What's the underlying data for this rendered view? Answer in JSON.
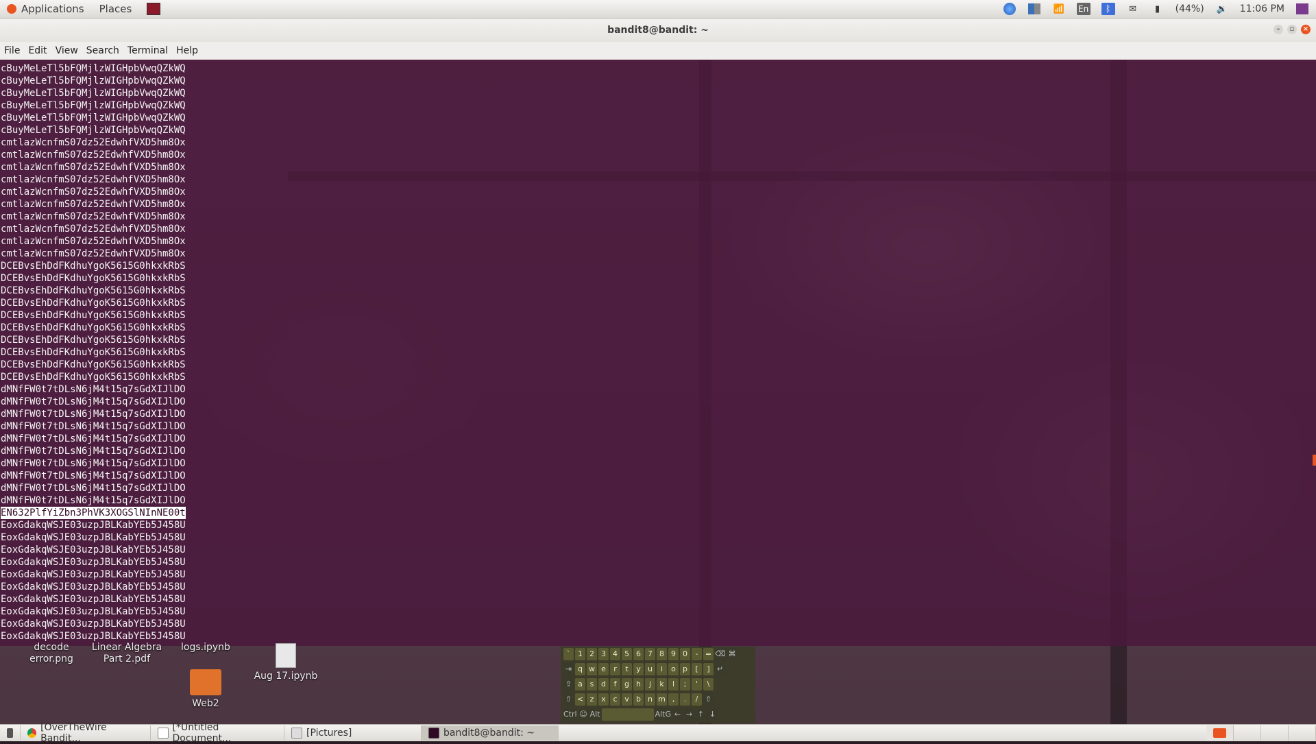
{
  "top_panel": {
    "applications": "Applications",
    "places": "Places",
    "keyboard_layout": "En",
    "battery": "(44%)",
    "clock": "11:06 PM"
  },
  "window": {
    "title": "bandit8@bandit: ~"
  },
  "menubar": [
    "File",
    "Edit",
    "View",
    "Search",
    "Terminal",
    "Help"
  ],
  "terminal": {
    "lines": [
      "cBuyMeLeTl5bFQMjlzWIGHpbVwqQZkWQ",
      "cBuyMeLeTl5bFQMjlzWIGHpbVwqQZkWQ",
      "cBuyMeLeTl5bFQMjlzWIGHpbVwqQZkWQ",
      "cBuyMeLeTl5bFQMjlzWIGHpbVwqQZkWQ",
      "cBuyMeLeTl5bFQMjlzWIGHpbVwqQZkWQ",
      "cBuyMeLeTl5bFQMjlzWIGHpbVwqQZkWQ",
      "cmtlazWcnfmS07dz52EdwhfVXD5hm8Ox",
      "cmtlazWcnfmS07dz52EdwhfVXD5hm8Ox",
      "cmtlazWcnfmS07dz52EdwhfVXD5hm8Ox",
      "cmtlazWcnfmS07dz52EdwhfVXD5hm8Ox",
      "cmtlazWcnfmS07dz52EdwhfVXD5hm8Ox",
      "cmtlazWcnfmS07dz52EdwhfVXD5hm8Ox",
      "cmtlazWcnfmS07dz52EdwhfVXD5hm8Ox",
      "cmtlazWcnfmS07dz52EdwhfVXD5hm8Ox",
      "cmtlazWcnfmS07dz52EdwhfVXD5hm8Ox",
      "cmtlazWcnfmS07dz52EdwhfVXD5hm8Ox",
      "DCEBvsEhDdFKdhuYgoK5615G0hkxkRbS",
      "DCEBvsEhDdFKdhuYgoK5615G0hkxkRbS",
      "DCEBvsEhDdFKdhuYgoK5615G0hkxkRbS",
      "DCEBvsEhDdFKdhuYgoK5615G0hkxkRbS",
      "DCEBvsEhDdFKdhuYgoK5615G0hkxkRbS",
      "DCEBvsEhDdFKdhuYgoK5615G0hkxkRbS",
      "DCEBvsEhDdFKdhuYgoK5615G0hkxkRbS",
      "DCEBvsEhDdFKdhuYgoK5615G0hkxkRbS",
      "DCEBvsEhDdFKdhuYgoK5615G0hkxkRbS",
      "DCEBvsEhDdFKdhuYgoK5615G0hkxkRbS",
      "dMNfFW0t7tDLsN6jM4t15q7sGdXIJlDO",
      "dMNfFW0t7tDLsN6jM4t15q7sGdXIJlDO",
      "dMNfFW0t7tDLsN6jM4t15q7sGdXIJlDO",
      "dMNfFW0t7tDLsN6jM4t15q7sGdXIJlDO",
      "dMNfFW0t7tDLsN6jM4t15q7sGdXIJlDO",
      "dMNfFW0t7tDLsN6jM4t15q7sGdXIJlDO",
      "dMNfFW0t7tDLsN6jM4t15q7sGdXIJlDO",
      "dMNfFW0t7tDLsN6jM4t15q7sGdXIJlDO",
      "dMNfFW0t7tDLsN6jM4t15q7sGdXIJlDO",
      "dMNfFW0t7tDLsN6jM4t15q7sGdXIJlDO",
      "EN632PlfYiZbn3PhVK3XOGSlNInNE00t",
      "EoxGdakqWSJE03uzpJBLKabYEb5J458U",
      "EoxGdakqWSJE03uzpJBLKabYEb5J458U",
      "EoxGdakqWSJE03uzpJBLKabYEb5J458U",
      "EoxGdakqWSJE03uzpJBLKabYEb5J458U",
      "EoxGdakqWSJE03uzpJBLKabYEb5J458U",
      "EoxGdakqWSJE03uzpJBLKabYEb5J458U",
      "EoxGdakqWSJE03uzpJBLKabYEb5J458U",
      "EoxGdakqWSJE03uzpJBLKabYEb5J458U",
      "EoxGdakqWSJE03uzpJBLKabYEb5J458U",
      "EoxGdakqWSJE03uzpJBLKabYEb5J458U"
    ],
    "highlighted_index": 36
  },
  "desktop_icons": [
    "decode error.png",
    "Linear Algebra Part 2.pdf",
    "logs.ipynb",
    "Aug 17.ipynb",
    "Web2"
  ],
  "keyboard": {
    "rows": [
      [
        "`",
        "1",
        "2",
        "3",
        "4",
        "5",
        "6",
        "7",
        "8",
        "9",
        "0",
        "-",
        "=",
        "⌫",
        "⌘"
      ],
      [
        "⇥",
        "q",
        "w",
        "e",
        "r",
        "t",
        "y",
        "u",
        "i",
        "o",
        "p",
        "[",
        "]",
        "↵"
      ],
      [
        "⇪",
        "a",
        "s",
        "d",
        "f",
        "g",
        "h",
        "j",
        "k",
        "l",
        ";",
        "'",
        "\\"
      ],
      [
        "⇧",
        "<",
        "z",
        "x",
        "c",
        "v",
        "b",
        "n",
        "m",
        ",",
        ".",
        "/",
        "⇧"
      ],
      [
        "Ctrl",
        "☺",
        "Alt",
        "",
        "AltG",
        "←",
        "→",
        "↑",
        "↓"
      ]
    ]
  },
  "taskbar": {
    "items": [
      {
        "label": "[OverTheWire Bandit..."
      },
      {
        "label": "[*Untitled Document..."
      },
      {
        "label": "[Pictures]"
      },
      {
        "label": "bandit8@bandit: ~"
      }
    ]
  },
  "colors": {
    "terminal_bg": "#4a193c",
    "accent": "#e95420"
  }
}
